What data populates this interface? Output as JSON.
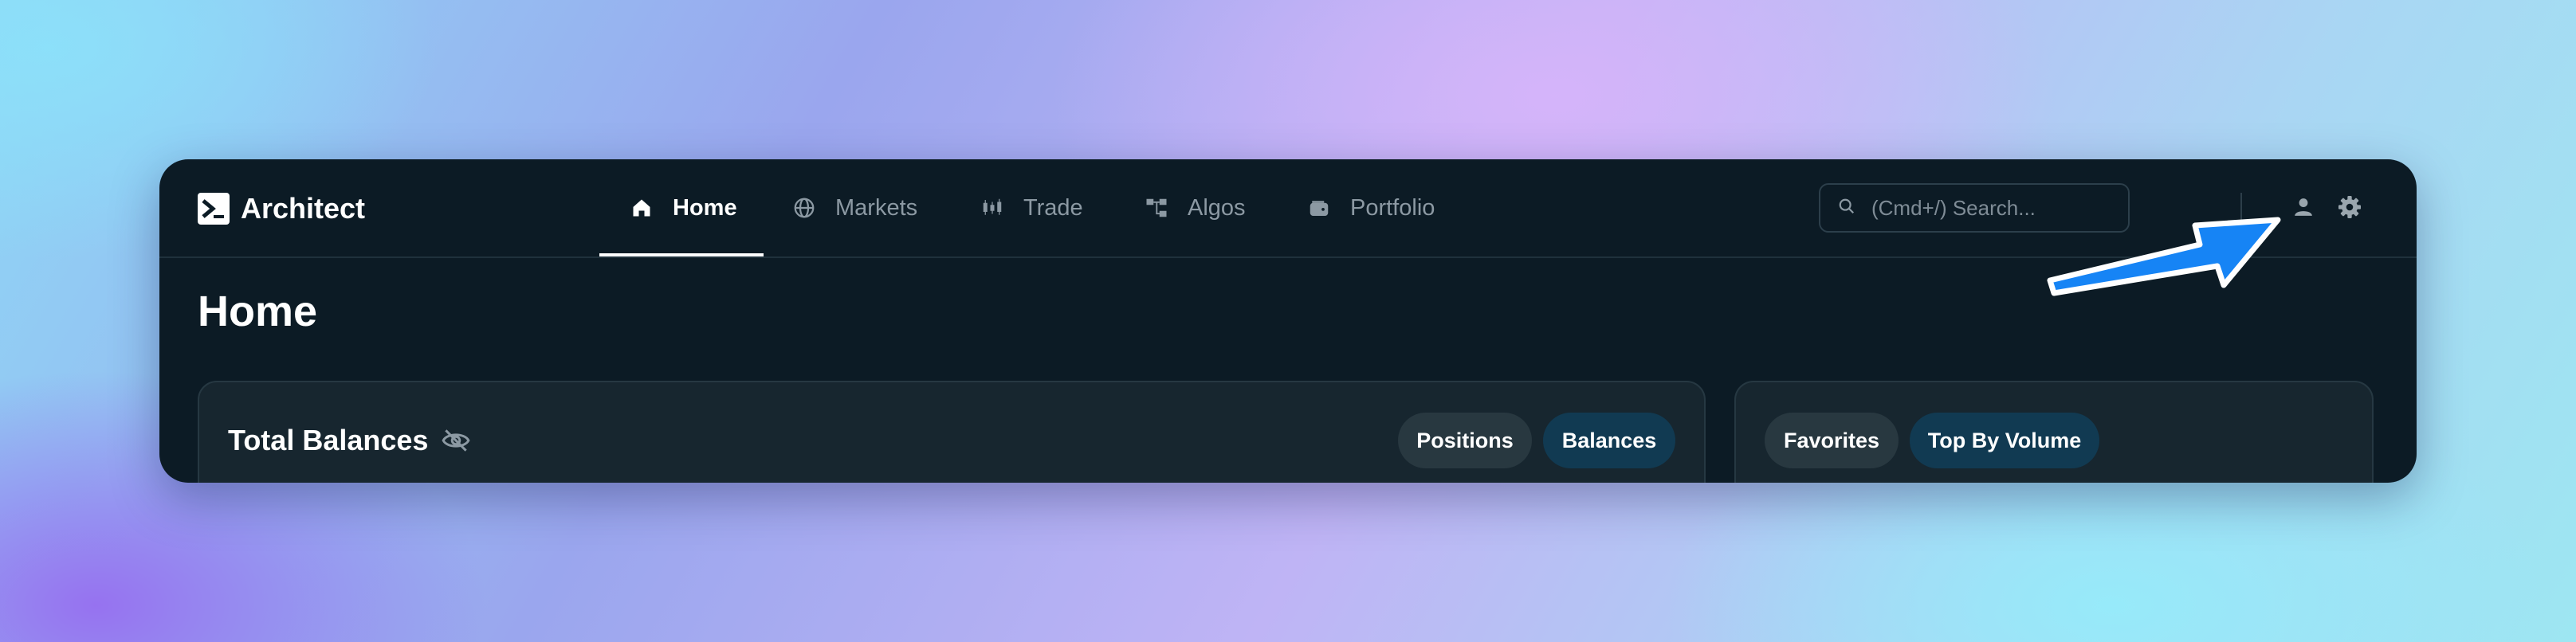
{
  "app": {
    "brand_name": "Architect"
  },
  "nav": {
    "items": [
      {
        "label": "Home",
        "icon": "home-icon",
        "active": true
      },
      {
        "label": "Markets",
        "icon": "globe-icon",
        "active": false
      },
      {
        "label": "Trade",
        "icon": "candlestick-icon",
        "active": false
      },
      {
        "label": "Algos",
        "icon": "workflow-icon",
        "active": false
      },
      {
        "label": "Portfolio",
        "icon": "wallet-icon",
        "active": false
      }
    ]
  },
  "search": {
    "placeholder": "(Cmd+/) Search...",
    "value": ""
  },
  "header_actions": {
    "user_icon": "user-icon",
    "settings_icon": "gear-icon"
  },
  "page": {
    "title": "Home"
  },
  "balances_panel": {
    "title": "Total Balances",
    "hide_icon": "eye-off-icon",
    "tabs": [
      {
        "label": "Positions",
        "active": false
      },
      {
        "label": "Balances",
        "active": true
      }
    ]
  },
  "markets_panel": {
    "tabs": [
      {
        "label": "Favorites",
        "active": false
      },
      {
        "label": "Top By Volume",
        "active": true
      }
    ]
  },
  "annotation": {
    "arrow_icon": "pointer-arrow",
    "arrow_color": "#1684f5"
  },
  "colors": {
    "window_bg": "#0c1b25",
    "panel_bg": "#17262f",
    "accent_pill": "#113a52",
    "muted_pill": "#283840"
  }
}
